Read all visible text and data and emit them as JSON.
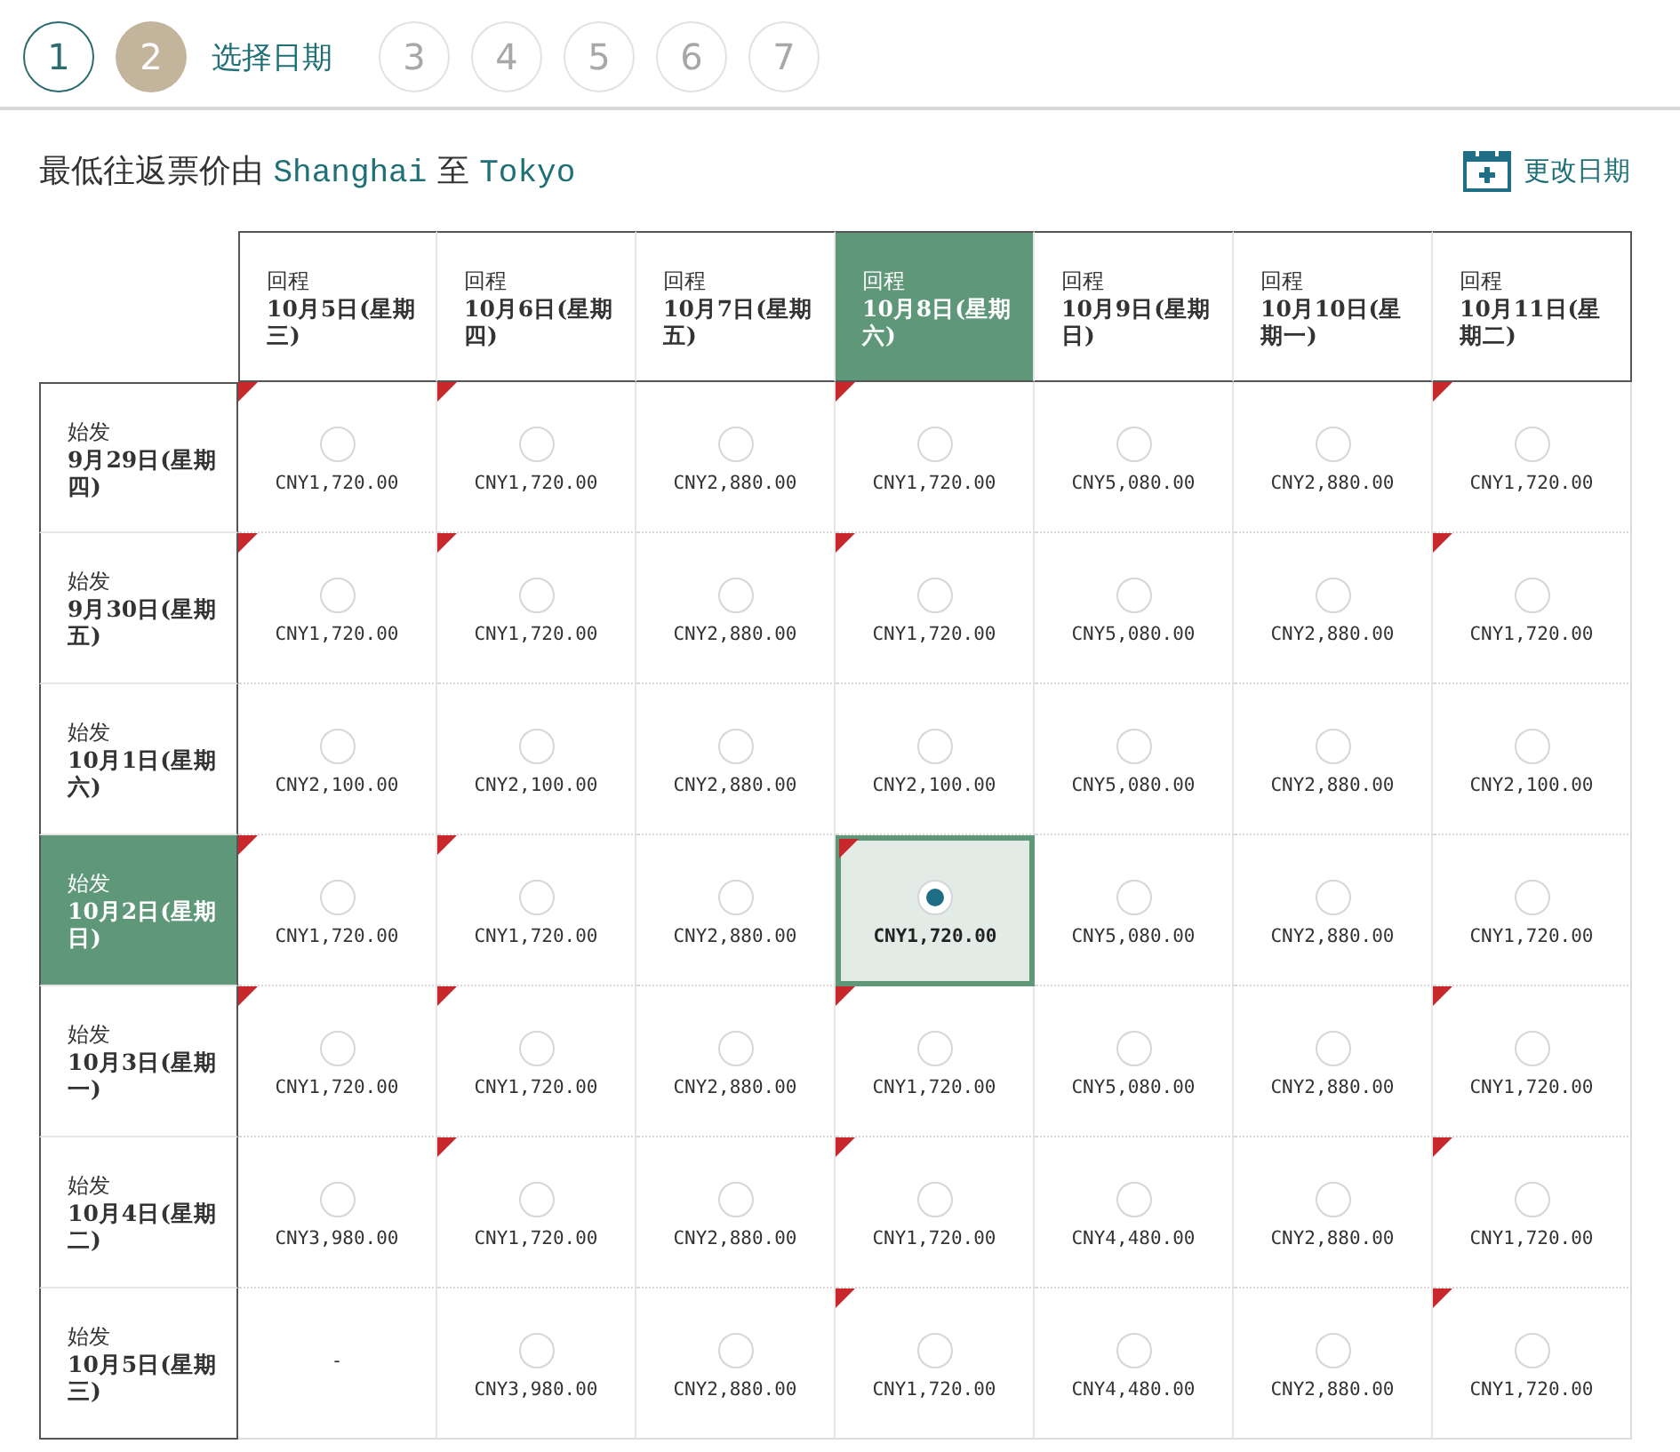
{
  "steps": [
    {
      "label": "1",
      "completed": true,
      "selected": false
    },
    {
      "label": "2",
      "completed": false,
      "selected": true,
      "title": "选择日期"
    },
    {
      "label": "3",
      "completed": false,
      "selected": false
    },
    {
      "label": "4",
      "completed": false,
      "selected": false
    },
    {
      "label": "5",
      "completed": false,
      "selected": false
    },
    {
      "label": "6",
      "completed": false,
      "selected": false
    },
    {
      "label": "7",
      "completed": false,
      "selected": false
    }
  ],
  "heading": {
    "prefix": "最低往返票价由",
    "origin": "Shanghai",
    "joiner": "至",
    "destination": "Tokyo"
  },
  "change_date": "更改日期",
  "columns": [
    {
      "label": "回程",
      "date": "10月5日(星期三)",
      "selected": false
    },
    {
      "label": "回程",
      "date": "10月6日(星期四)",
      "selected": false
    },
    {
      "label": "回程",
      "date": "10月7日(星期五)",
      "selected": false
    },
    {
      "label": "回程",
      "date": "10月8日(星期六)",
      "selected": true
    },
    {
      "label": "回程",
      "date": "10月9日(星期日)",
      "selected": false
    },
    {
      "label": "回程",
      "date": "10月10日(星期一)",
      "selected": false
    },
    {
      "label": "回程",
      "date": "10月11日(星期二)",
      "selected": false
    }
  ],
  "rows": [
    {
      "label": "始发",
      "date": "9月29日(星期四)",
      "selected": false,
      "cells": [
        {
          "kind": "fare",
          "price": "CNY1,720.00",
          "flagged": true,
          "selected": false
        },
        {
          "kind": "fare",
          "price": "CNY1,720.00",
          "flagged": true,
          "selected": false
        },
        {
          "kind": "fare",
          "price": "CNY2,880.00",
          "flagged": false,
          "selected": false
        },
        {
          "kind": "fare",
          "price": "CNY1,720.00",
          "flagged": true,
          "selected": false
        },
        {
          "kind": "fare",
          "price": "CNY5,080.00",
          "flagged": false,
          "selected": false
        },
        {
          "kind": "fare",
          "price": "CNY2,880.00",
          "flagged": false,
          "selected": false
        },
        {
          "kind": "fare",
          "price": "CNY1,720.00",
          "flagged": true,
          "selected": false
        }
      ]
    },
    {
      "label": "始发",
      "date": "9月30日(星期五)",
      "selected": false,
      "cells": [
        {
          "kind": "fare",
          "price": "CNY1,720.00",
          "flagged": true,
          "selected": false
        },
        {
          "kind": "fare",
          "price": "CNY1,720.00",
          "flagged": true,
          "selected": false
        },
        {
          "kind": "fare",
          "price": "CNY2,880.00",
          "flagged": false,
          "selected": false
        },
        {
          "kind": "fare",
          "price": "CNY1,720.00",
          "flagged": true,
          "selected": false
        },
        {
          "kind": "fare",
          "price": "CNY5,080.00",
          "flagged": false,
          "selected": false
        },
        {
          "kind": "fare",
          "price": "CNY2,880.00",
          "flagged": false,
          "selected": false
        },
        {
          "kind": "fare",
          "price": "CNY1,720.00",
          "flagged": true,
          "selected": false
        }
      ]
    },
    {
      "label": "始发",
      "date": "10月1日(星期六)",
      "selected": false,
      "cells": [
        {
          "kind": "fare",
          "price": "CNY2,100.00",
          "flagged": false,
          "selected": false
        },
        {
          "kind": "fare",
          "price": "CNY2,100.00",
          "flagged": false,
          "selected": false
        },
        {
          "kind": "fare",
          "price": "CNY2,880.00",
          "flagged": false,
          "selected": false
        },
        {
          "kind": "fare",
          "price": "CNY2,100.00",
          "flagged": false,
          "selected": false
        },
        {
          "kind": "fare",
          "price": "CNY5,080.00",
          "flagged": false,
          "selected": false
        },
        {
          "kind": "fare",
          "price": "CNY2,880.00",
          "flagged": false,
          "selected": false
        },
        {
          "kind": "fare",
          "price": "CNY2,100.00",
          "flagged": false,
          "selected": false
        }
      ]
    },
    {
      "label": "始发",
      "date": "10月2日(星期日)",
      "selected": true,
      "cells": [
        {
          "kind": "fare",
          "price": "CNY1,720.00",
          "flagged": true,
          "selected": false
        },
        {
          "kind": "fare",
          "price": "CNY1,720.00",
          "flagged": true,
          "selected": false
        },
        {
          "kind": "fare",
          "price": "CNY2,880.00",
          "flagged": false,
          "selected": false
        },
        {
          "kind": "fare",
          "price": "CNY1,720.00",
          "flagged": true,
          "selected": true
        },
        {
          "kind": "fare",
          "price": "CNY5,080.00",
          "flagged": false,
          "selected": false
        },
        {
          "kind": "fare",
          "price": "CNY2,880.00",
          "flagged": false,
          "selected": false
        },
        {
          "kind": "fare",
          "price": "CNY1,720.00",
          "flagged": false,
          "selected": false
        }
      ]
    },
    {
      "label": "始发",
      "date": "10月3日(星期一)",
      "selected": false,
      "cells": [
        {
          "kind": "fare",
          "price": "CNY1,720.00",
          "flagged": true,
          "selected": false
        },
        {
          "kind": "fare",
          "price": "CNY1,720.00",
          "flagged": true,
          "selected": false
        },
        {
          "kind": "fare",
          "price": "CNY2,880.00",
          "flagged": false,
          "selected": false
        },
        {
          "kind": "fare",
          "price": "CNY1,720.00",
          "flagged": true,
          "selected": false
        },
        {
          "kind": "fare",
          "price": "CNY5,080.00",
          "flagged": false,
          "selected": false
        },
        {
          "kind": "fare",
          "price": "CNY2,880.00",
          "flagged": false,
          "selected": false
        },
        {
          "kind": "fare",
          "price": "CNY1,720.00",
          "flagged": true,
          "selected": false
        }
      ]
    },
    {
      "label": "始发",
      "date": "10月4日(星期二)",
      "selected": false,
      "cells": [
        {
          "kind": "fare",
          "price": "CNY3,980.00",
          "flagged": false,
          "selected": false
        },
        {
          "kind": "fare",
          "price": "CNY1,720.00",
          "flagged": true,
          "selected": false
        },
        {
          "kind": "fare",
          "price": "CNY2,880.00",
          "flagged": false,
          "selected": false
        },
        {
          "kind": "fare",
          "price": "CNY1,720.00",
          "flagged": true,
          "selected": false
        },
        {
          "kind": "fare",
          "price": "CNY4,480.00",
          "flagged": false,
          "selected": false
        },
        {
          "kind": "fare",
          "price": "CNY2,880.00",
          "flagged": false,
          "selected": false
        },
        {
          "kind": "fare",
          "price": "CNY1,720.00",
          "flagged": true,
          "selected": false
        }
      ]
    },
    {
      "label": "始发",
      "date": "10月5日(星期三)",
      "selected": false,
      "cells": [
        {
          "kind": "empty",
          "price": "-"
        },
        {
          "kind": "fare",
          "price": "CNY3,980.00",
          "flagged": false,
          "selected": false
        },
        {
          "kind": "fare",
          "price": "CNY2,880.00",
          "flagged": false,
          "selected": false
        },
        {
          "kind": "fare",
          "price": "CNY1,720.00",
          "flagged": true,
          "selected": false
        },
        {
          "kind": "fare",
          "price": "CNY4,480.00",
          "flagged": false,
          "selected": false
        },
        {
          "kind": "fare",
          "price": "CNY2,880.00",
          "flagged": false,
          "selected": false
        },
        {
          "kind": "fare",
          "price": "CNY1,720.00",
          "flagged": true,
          "selected": false
        }
      ]
    }
  ]
}
